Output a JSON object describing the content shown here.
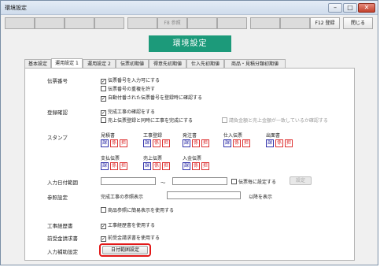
{
  "window": {
    "title": "環境設定",
    "min_glyph": "–",
    "max_glyph": "□",
    "close_glyph": "✕"
  },
  "fkeys": {
    "f8": "F8 参照",
    "f12": "F12 登録",
    "close": "閉じる"
  },
  "banner": "環境設定",
  "tabs": [
    "基本設定",
    "運用設定 1",
    "運用設定 2",
    "伝票初期値",
    "得意先初期値",
    "仕入先初期値",
    "商品・見積分類初期値"
  ],
  "selected_tab": "運用設定 1",
  "sections": {
    "denpyo": {
      "label": "伝票番号",
      "items": [
        "伝票番号を入力可にする",
        "伝票番号の重複を許す",
        "自動付番された伝票番号を登録時に確認する"
      ],
      "checked": [
        true,
        false,
        true
      ]
    },
    "toroku": {
      "label": "登録確認",
      "items": [
        "完成工事の確認をする",
        "売上伝票登録と同時に工事を完成にする",
        "請負金額と売上金額が一致しているか確認する"
      ],
      "checked": [
        true,
        false,
        false
      ]
    },
    "stamp": {
      "label": "スタンプ",
      "groups": [
        "見積書",
        "工事登録",
        "発注書",
        "仕入伝票",
        "出面書",
        "支払伝票",
        "売上伝票",
        "入金伝票"
      ],
      "chars": [
        "課",
        "係",
        "担"
      ]
    },
    "date": {
      "label": "入力日付範囲",
      "tilde": "～",
      "check": "伝票毎に設定する",
      "button": "設定"
    },
    "ref": {
      "label": "参照設定",
      "text": "完成工事の参照表示",
      "suffix": "以降を表示",
      "check": "商品参照に簡易表示を使用する"
    },
    "koji": {
      "label": "工事経歴書",
      "check": "工事経歴書を使用する"
    },
    "maeuke": {
      "label": "前受金請求書",
      "check": "前受金請求書を使用する"
    },
    "assist": {
      "label": "入力補助設定",
      "button": "日付範囲設定"
    }
  },
  "colors": {
    "banner": "#1c9a7a",
    "highlight": "#e21818",
    "stamp_red": "#dd3333",
    "stamp_blue": "#3333aa"
  }
}
